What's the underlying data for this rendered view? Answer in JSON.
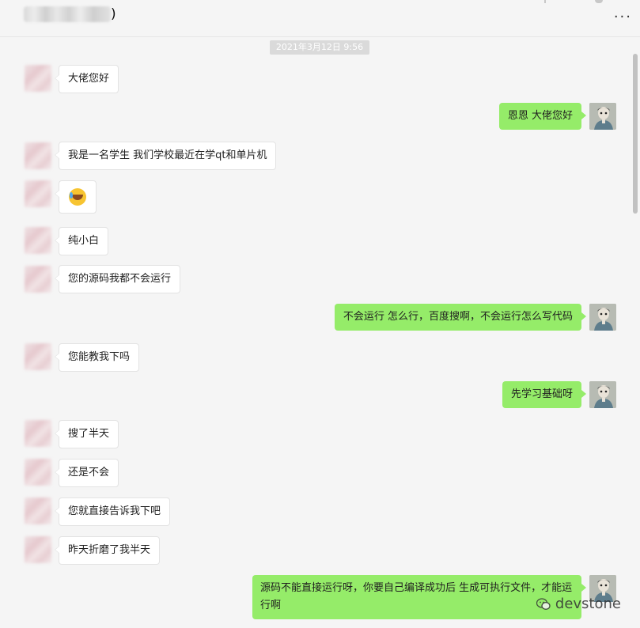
{
  "header": {
    "title_suffix": ")",
    "more": "···"
  },
  "timestamp": "2021年3月12日 9:56",
  "colors": {
    "bubble_self": "#95ec69",
    "bubble_other": "#ffffff",
    "background": "#f5f5f5"
  },
  "messages": [
    {
      "side": "left",
      "text": "大佬您好"
    },
    {
      "side": "right",
      "text": "恩恩 大佬您好"
    },
    {
      "side": "left",
      "text": "我是一名学生 我们学校最近在学qt和单片机"
    },
    {
      "side": "left",
      "text": "",
      "emoji": "laughing-crying-emoji"
    },
    {
      "side": "left",
      "text": "纯小白"
    },
    {
      "side": "left",
      "text": "您的源码我都不会运行"
    },
    {
      "side": "right",
      "text": "不会运行 怎么行，百度搜啊，不会运行怎么写代码"
    },
    {
      "side": "left",
      "text": "您能教我下吗"
    },
    {
      "side": "right",
      "text": "先学习基础呀"
    },
    {
      "side": "left",
      "text": "搜了半天"
    },
    {
      "side": "left",
      "text": "还是不会"
    },
    {
      "side": "left",
      "text": "您就直接告诉我下吧"
    },
    {
      "side": "left",
      "text": "昨天折磨了我半天"
    },
    {
      "side": "right",
      "text": "源码不能直接运行呀，你要自己编译成功后 生成可执行文件，才能运行啊"
    }
  ],
  "watermark": "devstone"
}
